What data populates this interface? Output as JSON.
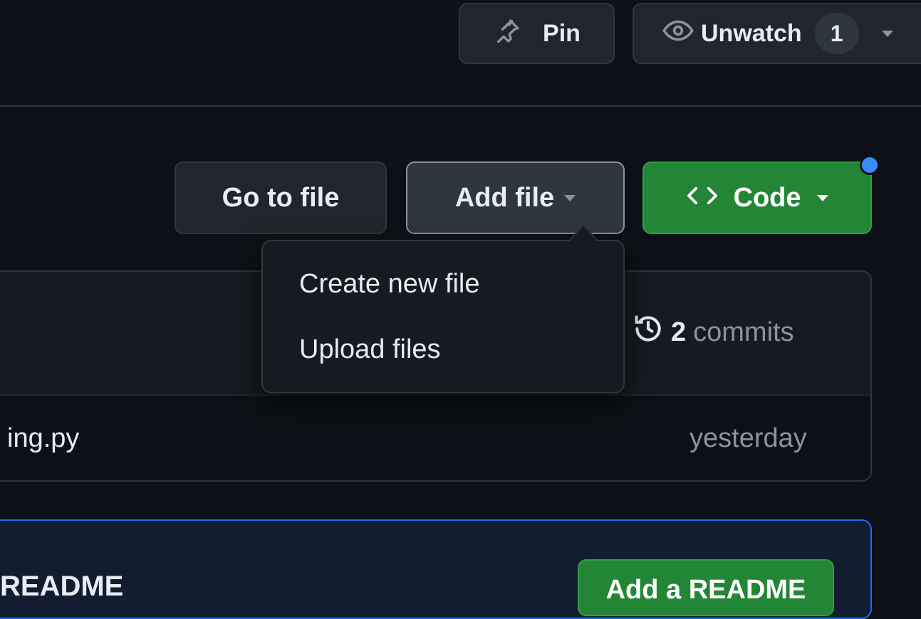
{
  "header": {
    "pin_label": "Pin",
    "unwatch_label": "Unwatch",
    "watch_count": "1"
  },
  "actions": {
    "go_to_file": "Go to file",
    "add_file": "Add file",
    "code": "Code"
  },
  "dropdown": {
    "items": [
      {
        "label": "Create new file"
      },
      {
        "label": "Upload files"
      }
    ]
  },
  "file_box": {
    "commit_count": "2",
    "commit_label": "commits",
    "file_name": "ing.py",
    "file_time": "yesterday"
  },
  "readme": {
    "text": "README",
    "button_label": "Add a README"
  },
  "colors": {
    "background": "#0d1117",
    "green": "#238636",
    "accent_blue": "#388bfd"
  }
}
